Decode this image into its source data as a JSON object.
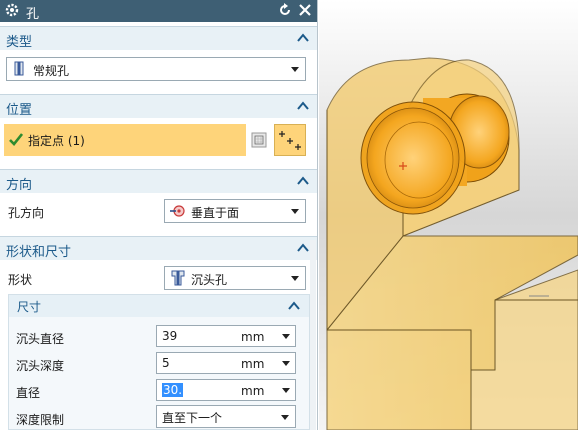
{
  "dialog": {
    "title": "孔",
    "sections": {
      "type": {
        "label": "类型",
        "hole_type": "常规孔"
      },
      "position": {
        "label": "位置",
        "specify_point": "指定点 (1)"
      },
      "direction": {
        "label": "方向",
        "hole_direction_label": "孔方向",
        "hole_direction_value": "垂直于面"
      },
      "shape": {
        "label": "形状和尺寸",
        "shape_label": "形状",
        "shape_value": "沉头孔",
        "dimensions": {
          "label": "尺寸",
          "counterbore_diameter_label": "沉头直径",
          "counterbore_diameter_value": "39",
          "counterbore_diameter_unit": "mm",
          "counterbore_depth_label": "沉头深度",
          "counterbore_depth_value": "5",
          "counterbore_depth_unit": "mm",
          "diameter_label": "直径",
          "diameter_value": "30.",
          "diameter_unit": "mm",
          "depth_limit_label": "深度限制",
          "depth_limit_value": "直至下一个"
        }
      }
    }
  },
  "colors": {
    "titlebar": "#3e5f74",
    "section_header_text": "#1c5a8a",
    "point_row_highlight": "#fed47a",
    "model_fill": "#f3c968",
    "model_edge": "#5a4a20",
    "hole_orange": "#f0a21a"
  }
}
